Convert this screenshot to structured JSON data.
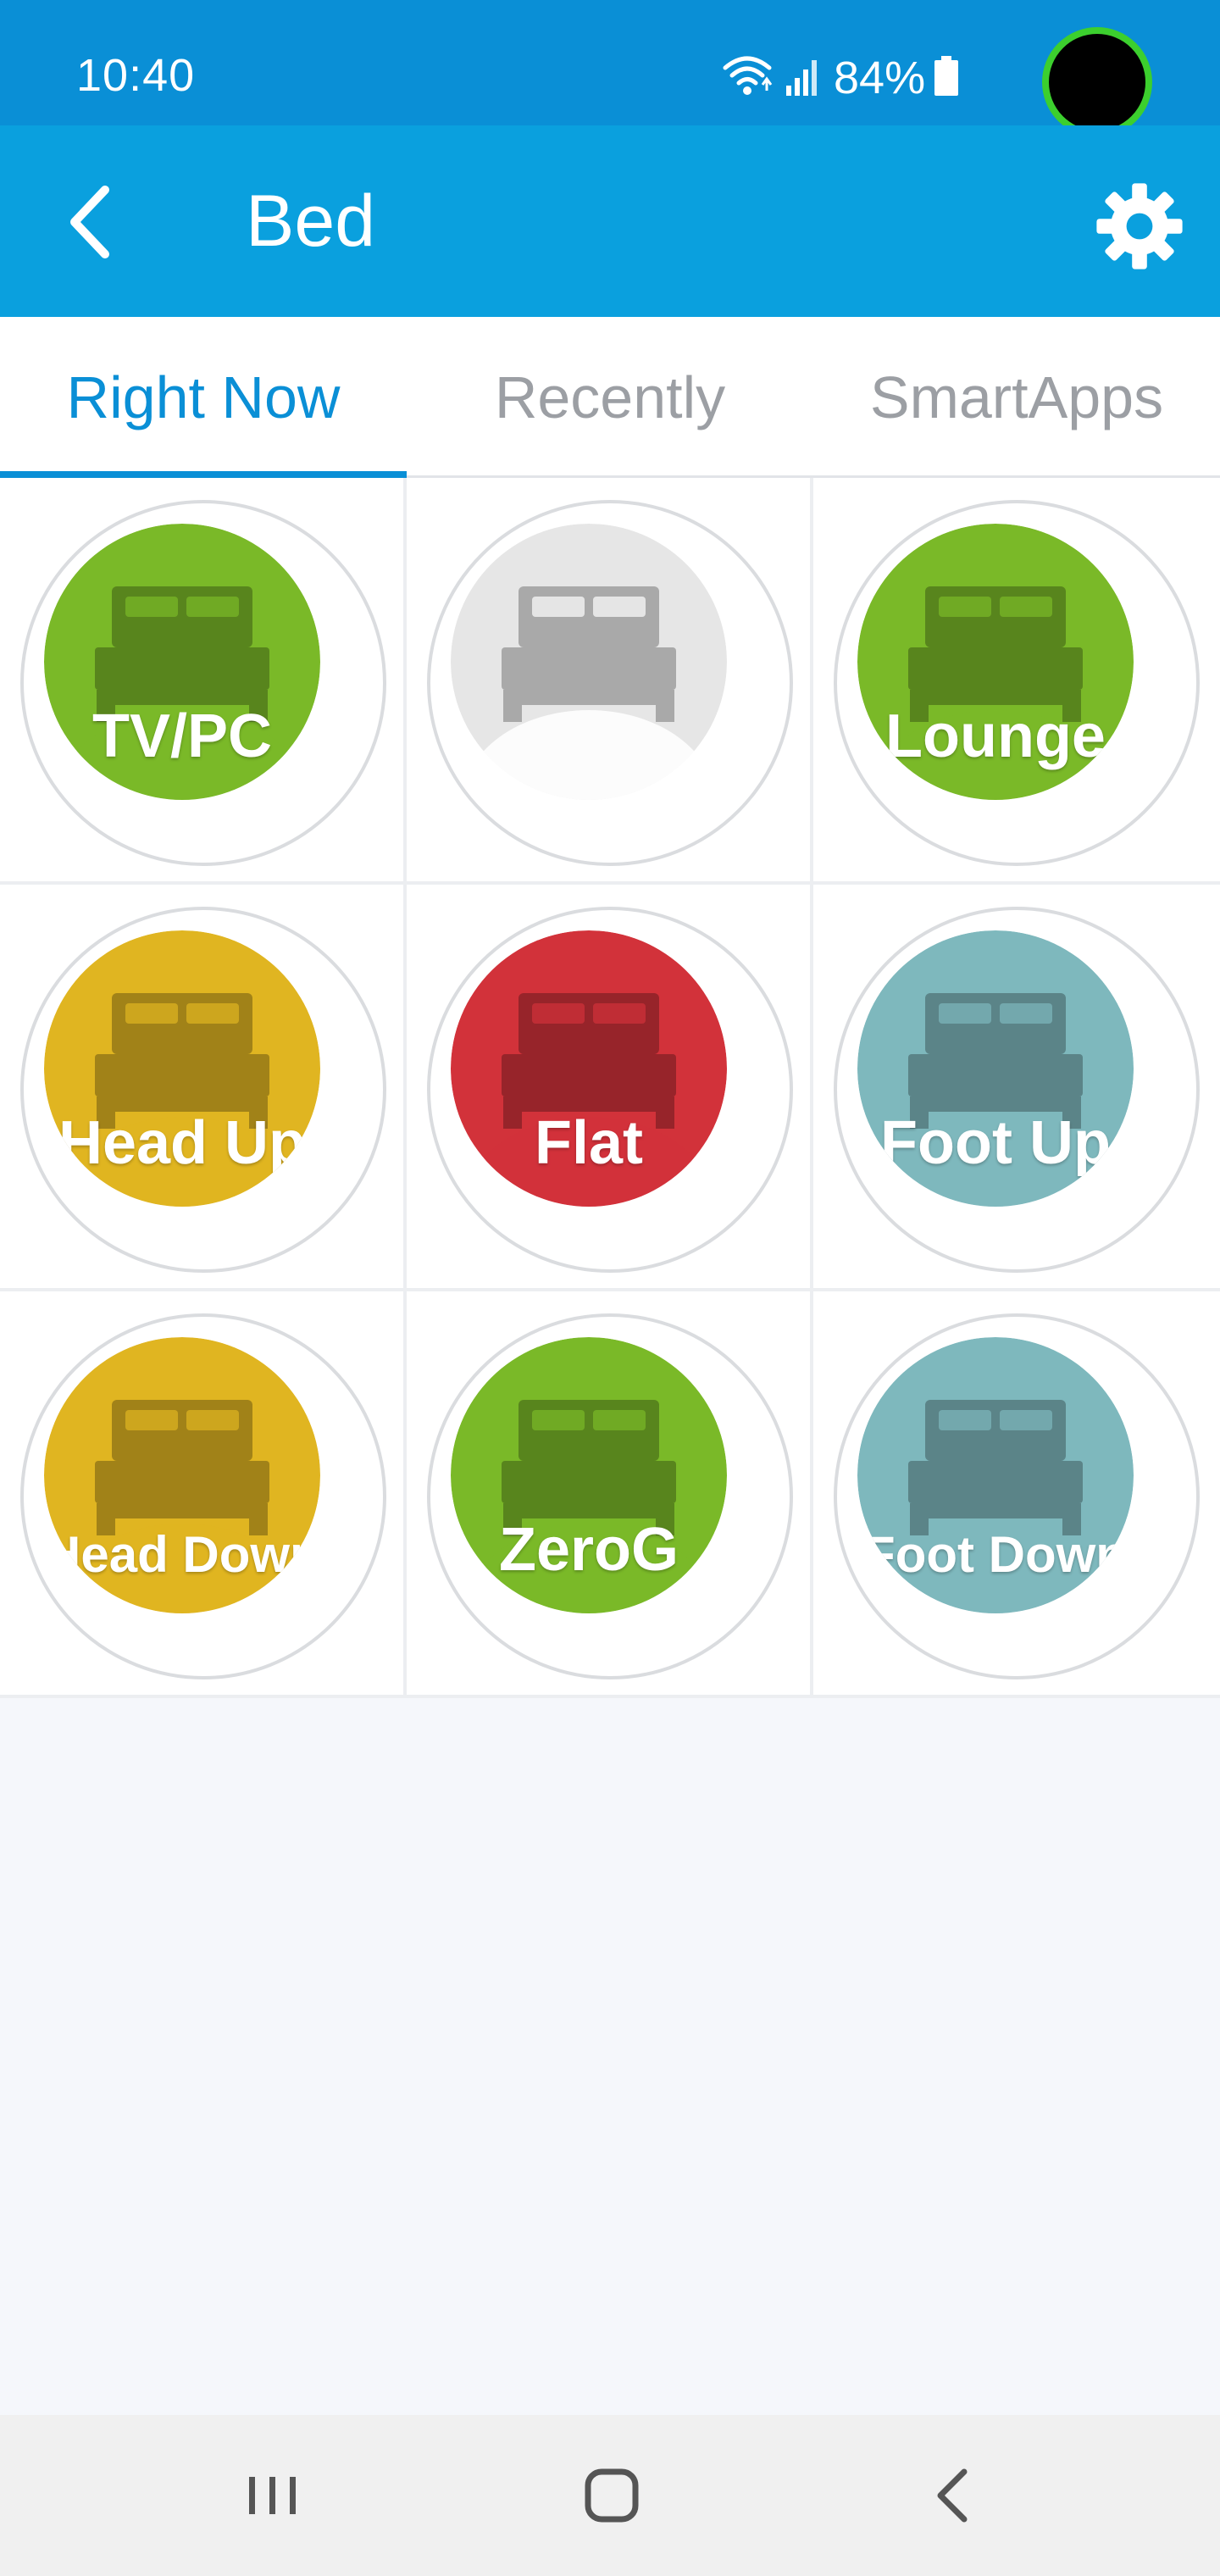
{
  "status_bar": {
    "time": "10:40",
    "battery": "84%"
  },
  "app_bar": {
    "title": "Bed",
    "back_icon": "chevron-left-icon",
    "settings_icon": "gear-icon"
  },
  "tabs": [
    {
      "label": "Right Now",
      "active": true
    },
    {
      "label": "Recently",
      "active": false
    },
    {
      "label": "SmartApps",
      "active": false
    }
  ],
  "tiles": [
    {
      "label": "TV/PC",
      "color": "#7ab928"
    },
    {
      "label": "",
      "color": "#e6e6e6"
    },
    {
      "label": "Lounge",
      "color": "#7ab928"
    },
    {
      "label": "Head Up",
      "color": "#e0b521"
    },
    {
      "label": "Flat",
      "color": "#d2323a"
    },
    {
      "label": "Foot Up",
      "color": "#7eb8bd"
    },
    {
      "label": "Head Down",
      "color": "#e0b521"
    },
    {
      "label": "ZeroG",
      "color": "#7ab928"
    },
    {
      "label": "Foot Down",
      "color": "#7eb8bd"
    }
  ],
  "colors": {
    "status_bar": "#0a8fd6",
    "app_bar": "#0aa0de",
    "accent": "#0a8fd6"
  },
  "nav_bar": {
    "recents_icon": "recents-icon",
    "home_icon": "home-icon",
    "back_icon": "back-icon"
  }
}
